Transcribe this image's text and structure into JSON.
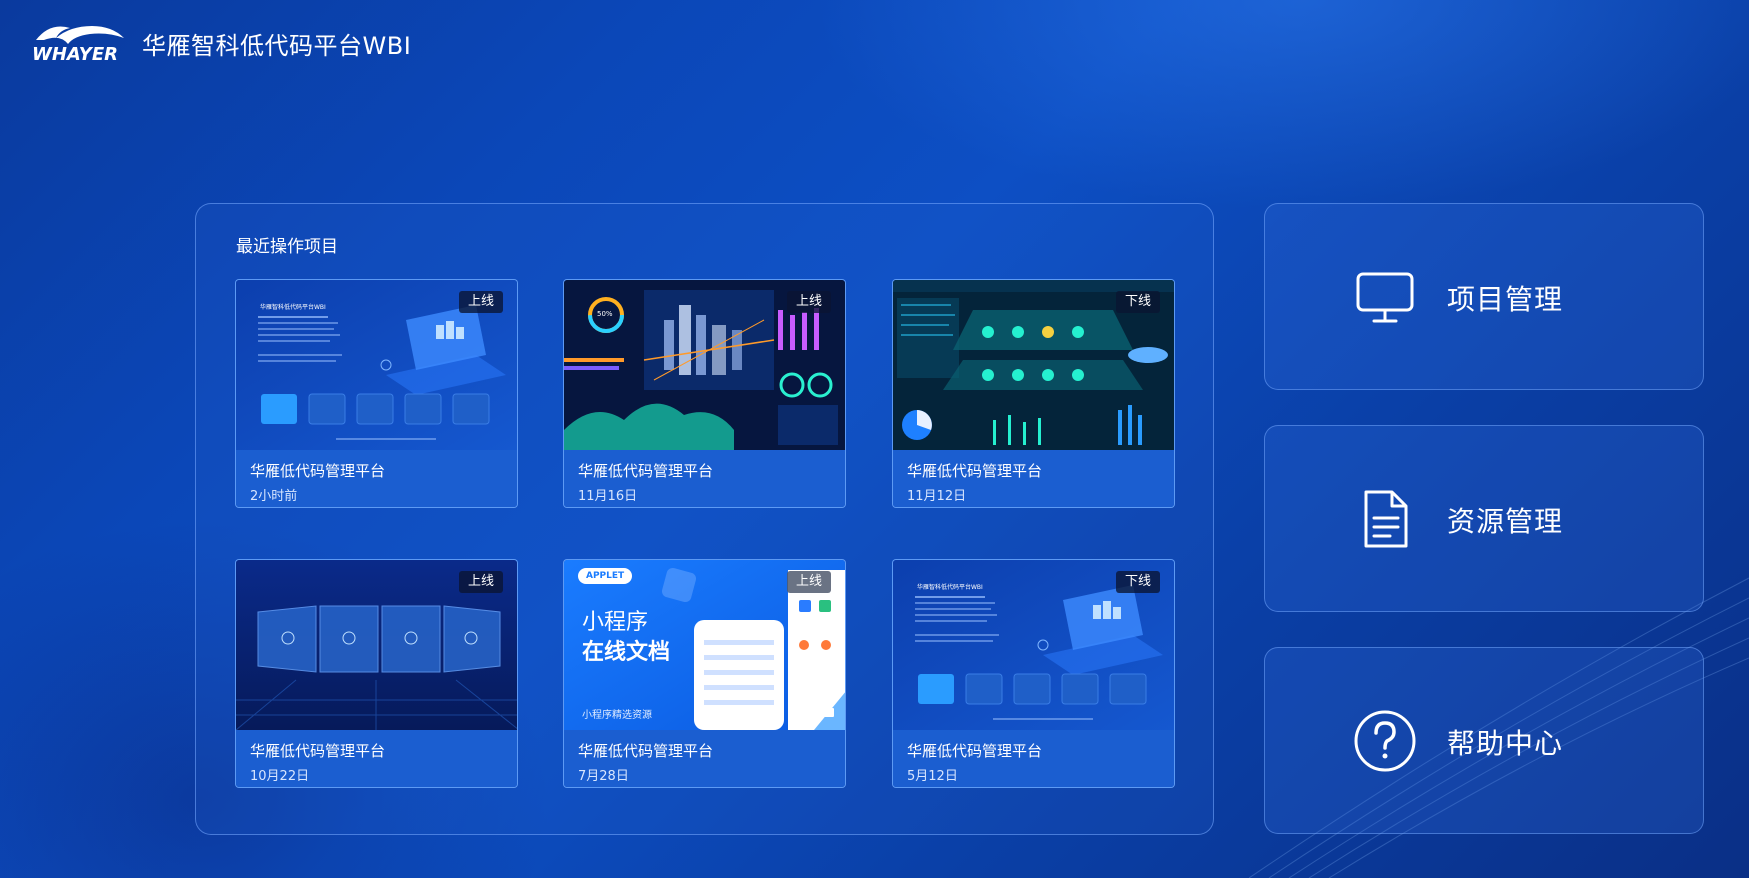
{
  "header": {
    "logo_text": "WHAYER",
    "app_title": "华雁智科低代码平台WBI"
  },
  "recent": {
    "title": "最近操作项目",
    "projects": [
      {
        "name": "华雁低代码管理平台",
        "time": "2小时前",
        "status": "上线"
      },
      {
        "name": "华雁低代码管理平台",
        "time": "11月16日",
        "status": "上线"
      },
      {
        "name": "华雁低代码管理平台",
        "time": "11月12日",
        "status": "下线"
      },
      {
        "name": "华雁低代码管理平台",
        "time": "10月22日",
        "status": "上线"
      },
      {
        "name": "华雁低代码管理平台",
        "time": "7月28日",
        "status": "上线"
      },
      {
        "name": "华雁低代码管理平台",
        "time": "5月12日",
        "status": "下线"
      }
    ]
  },
  "nav": [
    {
      "label": "项目管理",
      "icon": "monitor-icon"
    },
    {
      "label": "资源管理",
      "icon": "document-icon"
    },
    {
      "label": "帮助中心",
      "icon": "help-icon"
    }
  ],
  "thumbs": {
    "p1_title": "华雁智科低代码平台WBI",
    "p5_tag": "APPLET",
    "p5_line1": "小程序",
    "p5_line2": "在线文档",
    "p5_caption": "小程序精选资源",
    "p2_gauge": "50%"
  },
  "colors": {
    "background": "#0b47b8",
    "card_info": "#1b5ed0",
    "badge": "#0a1432",
    "accent": "#2aa6ff"
  }
}
